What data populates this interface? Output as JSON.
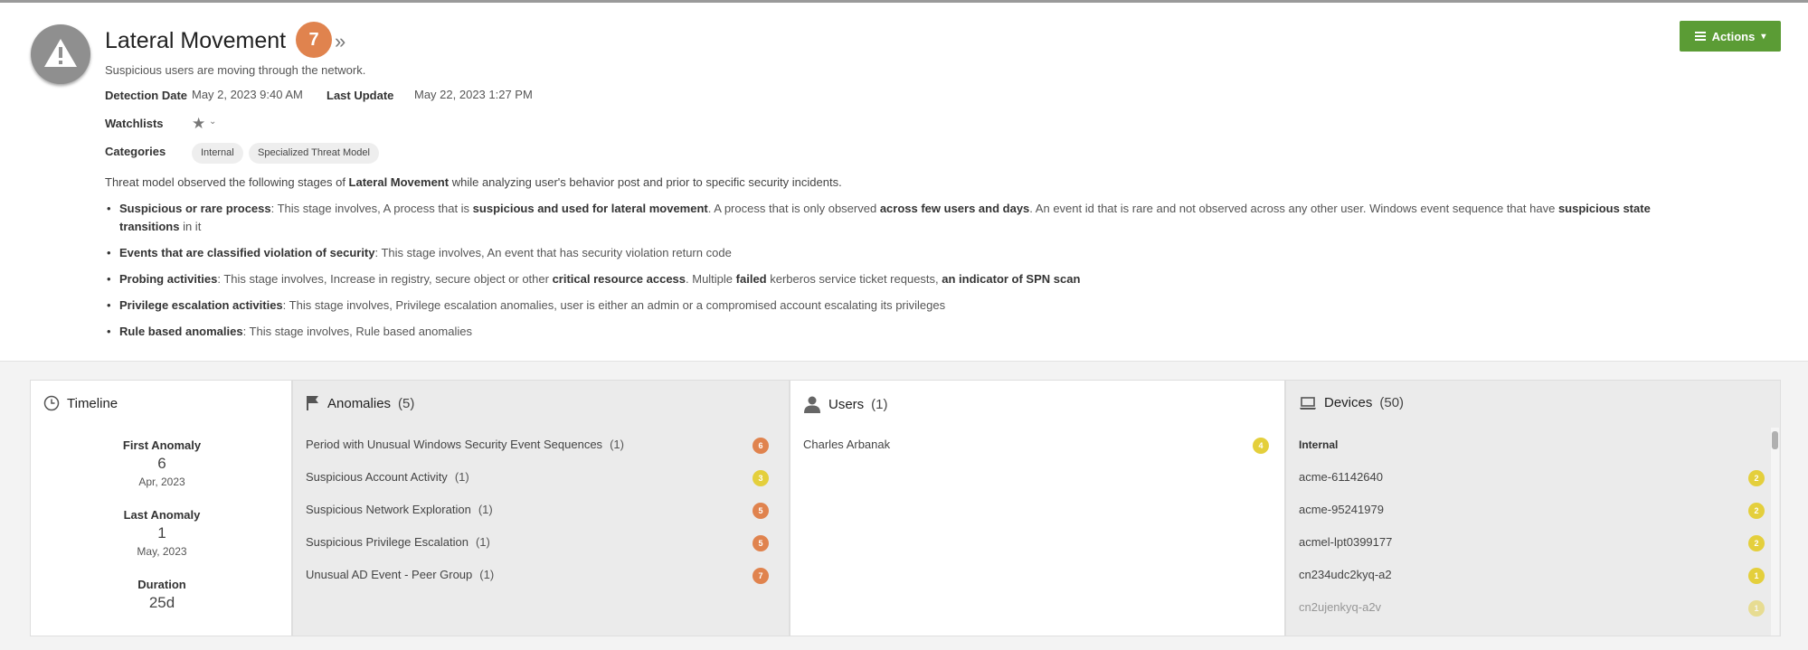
{
  "header": {
    "title": "Lateral Movement",
    "risk_score": "7",
    "expand_icon": "double-chevron-right-icon",
    "subtitle": "Suspicious users are moving through the network.",
    "detection_date_label": "Detection Date",
    "detection_date": "May 2, 2023 9:40 AM",
    "last_update_label": "Last Update",
    "last_update": "May 22, 2023 1:27 PM",
    "watchlists_label": "Watchlists",
    "categories_label": "Categories",
    "categories": [
      "Internal",
      "Specialized Threat Model"
    ],
    "description": {
      "prefix": "Threat model observed the following stages of ",
      "name": "Lateral Movement",
      "suffix": " while analyzing user's behavior post and prior to specific security incidents."
    },
    "stages": [
      {
        "name": "Suspicious or rare process",
        "t1": ": This stage involves, A process that is ",
        "b1": "suspicious and used for lateral movement",
        "t2": ". A process that is only observed ",
        "b2": "across few users and days",
        "t3": ". An event id that is rare and not observed across any other user. Windows event sequence that have ",
        "b3": "suspicious state transitions",
        "t4": " in it"
      },
      {
        "name": "Events that are classified violation of security",
        "t1": ": This stage involves, An event that has security violation return code"
      },
      {
        "name": "Probing activities",
        "t1": ": This stage involves, Increase in registry, secure object or other ",
        "b1": "critical resource access",
        "t2": ". Multiple ",
        "b2": "failed",
        "t3": " kerberos service ticket requests, ",
        "b3": "an indicator of SPN scan"
      },
      {
        "name": "Privilege escalation activities",
        "t1": ": This stage involves, Privilege escalation anomalies, user is either an admin or a compromised account escalating its privileges"
      },
      {
        "name": "Rule based anomalies",
        "t1": ": This stage involves, Rule based anomalies"
      }
    ],
    "actions_label": "Actions"
  },
  "timeline": {
    "title": "Timeline",
    "first_anomaly_label": "First Anomaly",
    "first_anomaly_day": "6",
    "first_anomaly_month": "Apr, 2023",
    "last_anomaly_label": "Last Anomaly",
    "last_anomaly_day": "1",
    "last_anomaly_month": "May, 2023",
    "duration_label": "Duration",
    "duration": "25d"
  },
  "anomalies": {
    "title": "Anomalies",
    "count": "(5)",
    "items": [
      {
        "name": "Period with Unusual Windows Security Event Sequences",
        "count": "(1)",
        "score": "6",
        "color": "#e0834e"
      },
      {
        "name": "Suspicious Account Activity",
        "count": "(1)",
        "score": "3",
        "color": "#e4cf3c"
      },
      {
        "name": "Suspicious Network Exploration",
        "count": "(1)",
        "score": "5",
        "color": "#e0834e"
      },
      {
        "name": "Suspicious Privilege Escalation",
        "count": "(1)",
        "score": "5",
        "color": "#e0834e"
      },
      {
        "name": "Unusual AD Event - Peer Group",
        "count": "(1)",
        "score": "7",
        "color": "#e0834e"
      }
    ]
  },
  "users": {
    "title": "Users",
    "count": "(1)",
    "items": [
      {
        "name": "Charles Arbanak",
        "score": "4",
        "color": "#e4cf3c"
      }
    ]
  },
  "devices": {
    "title": "Devices",
    "count": "(50)",
    "section_label": "Internal",
    "items": [
      {
        "name": "acme-61142640",
        "score": "2"
      },
      {
        "name": "acme-95241979",
        "score": "2"
      },
      {
        "name": "acmel-lpt0399177",
        "score": "2"
      },
      {
        "name": "cn234udc2kyq-a2",
        "score": "1"
      },
      {
        "name": "cn2ujenkyq-a2v",
        "score": "1"
      }
    ]
  }
}
